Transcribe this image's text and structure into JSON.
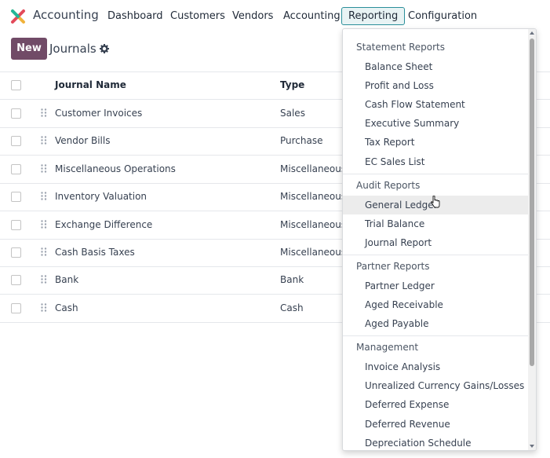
{
  "navbar": {
    "app_name": "Accounting",
    "logo_icon": "odoo-accounting-logo-icon",
    "items": [
      "Dashboard",
      "Customers",
      "Vendors",
      "Accounting",
      "Reporting",
      "Configuration"
    ],
    "active_item": "Reporting"
  },
  "control_panel": {
    "new_label": "New",
    "title": "Journals",
    "settings_icon": "gear-icon"
  },
  "table": {
    "columns": [
      "Journal Name",
      "Type"
    ],
    "rows": [
      {
        "name": "Customer Invoices",
        "type": "Sales"
      },
      {
        "name": "Vendor Bills",
        "type": "Purchase"
      },
      {
        "name": "Miscellaneous Operations",
        "type": "Miscellaneous"
      },
      {
        "name": "Inventory Valuation",
        "type": "Miscellaneous"
      },
      {
        "name": "Exchange Difference",
        "type": "Miscellaneous"
      },
      {
        "name": "Cash Basis Taxes",
        "type": "Miscellaneous"
      },
      {
        "name": "Bank",
        "type": "Bank"
      },
      {
        "name": "Cash",
        "type": "Cash"
      }
    ]
  },
  "reporting_menu": {
    "sections": [
      {
        "title": "Statement Reports",
        "items": [
          "Balance Sheet",
          "Profit and Loss",
          "Cash Flow Statement",
          "Executive Summary",
          "Tax Report",
          "EC Sales List"
        ]
      },
      {
        "title": "Audit Reports",
        "items": [
          "General Ledger",
          "Trial Balance",
          "Journal Report"
        ]
      },
      {
        "title": "Partner Reports",
        "items": [
          "Partner Ledger",
          "Aged Receivable",
          "Aged Payable"
        ]
      },
      {
        "title": "Management",
        "items": [
          "Invoice Analysis",
          "Unrealized Currency Gains/Losses",
          "Deferred Expense",
          "Deferred Revenue",
          "Depreciation Schedule"
        ]
      }
    ],
    "hovered_item": "General Ledger"
  },
  "colors": {
    "primary": "#714b67",
    "active_tab_border": "#2a8f9a"
  }
}
